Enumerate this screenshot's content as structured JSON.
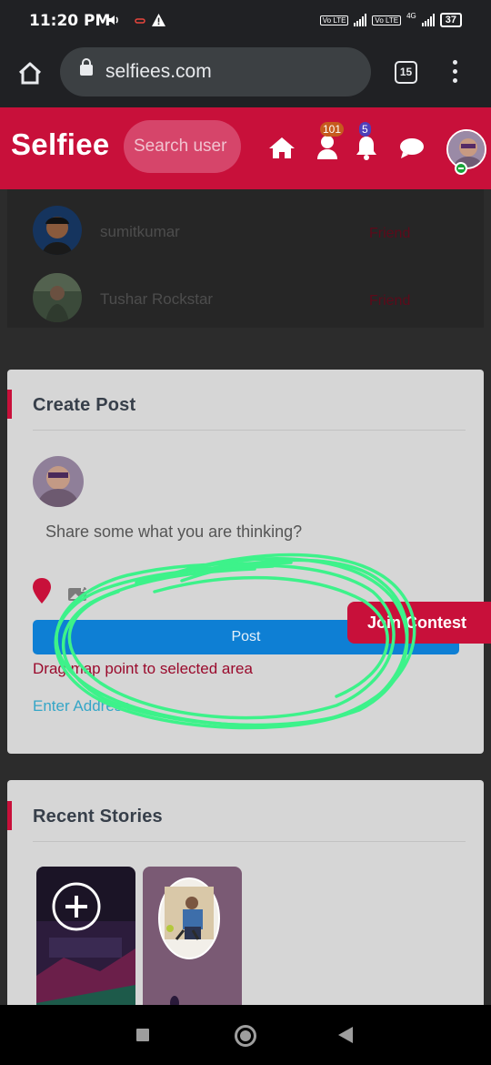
{
  "status_bar": {
    "time": "11:20 PM",
    "battery": "37",
    "network": "4G",
    "volte_label": "Vo LTE"
  },
  "browser": {
    "url": "selfiees.com",
    "tab_count": "15"
  },
  "header": {
    "logo": "Selfiee",
    "search_placeholder": "Search user",
    "friend_requests_badge": "101",
    "notifications_badge": "5",
    "brand_color": "#c8103a"
  },
  "friends": [
    {
      "name": "sumitkumar",
      "status": "Friend"
    },
    {
      "name": "Tushar Rockstar",
      "status": "Friend"
    }
  ],
  "create_post": {
    "title": "Create Post",
    "prompt": "Share some what you are thinking?",
    "post_button": "Post",
    "drag_hint": "Drag map point to selected area",
    "enter_address": "Enter Address"
  },
  "join_contest": "Join Contest",
  "recent_stories": {
    "title": "Recent Stories"
  },
  "icons": [
    "home-icon",
    "lock-icon",
    "user-icon",
    "bell-icon",
    "chat-icon",
    "map-pin-icon",
    "image-icon",
    "plus-icon"
  ]
}
